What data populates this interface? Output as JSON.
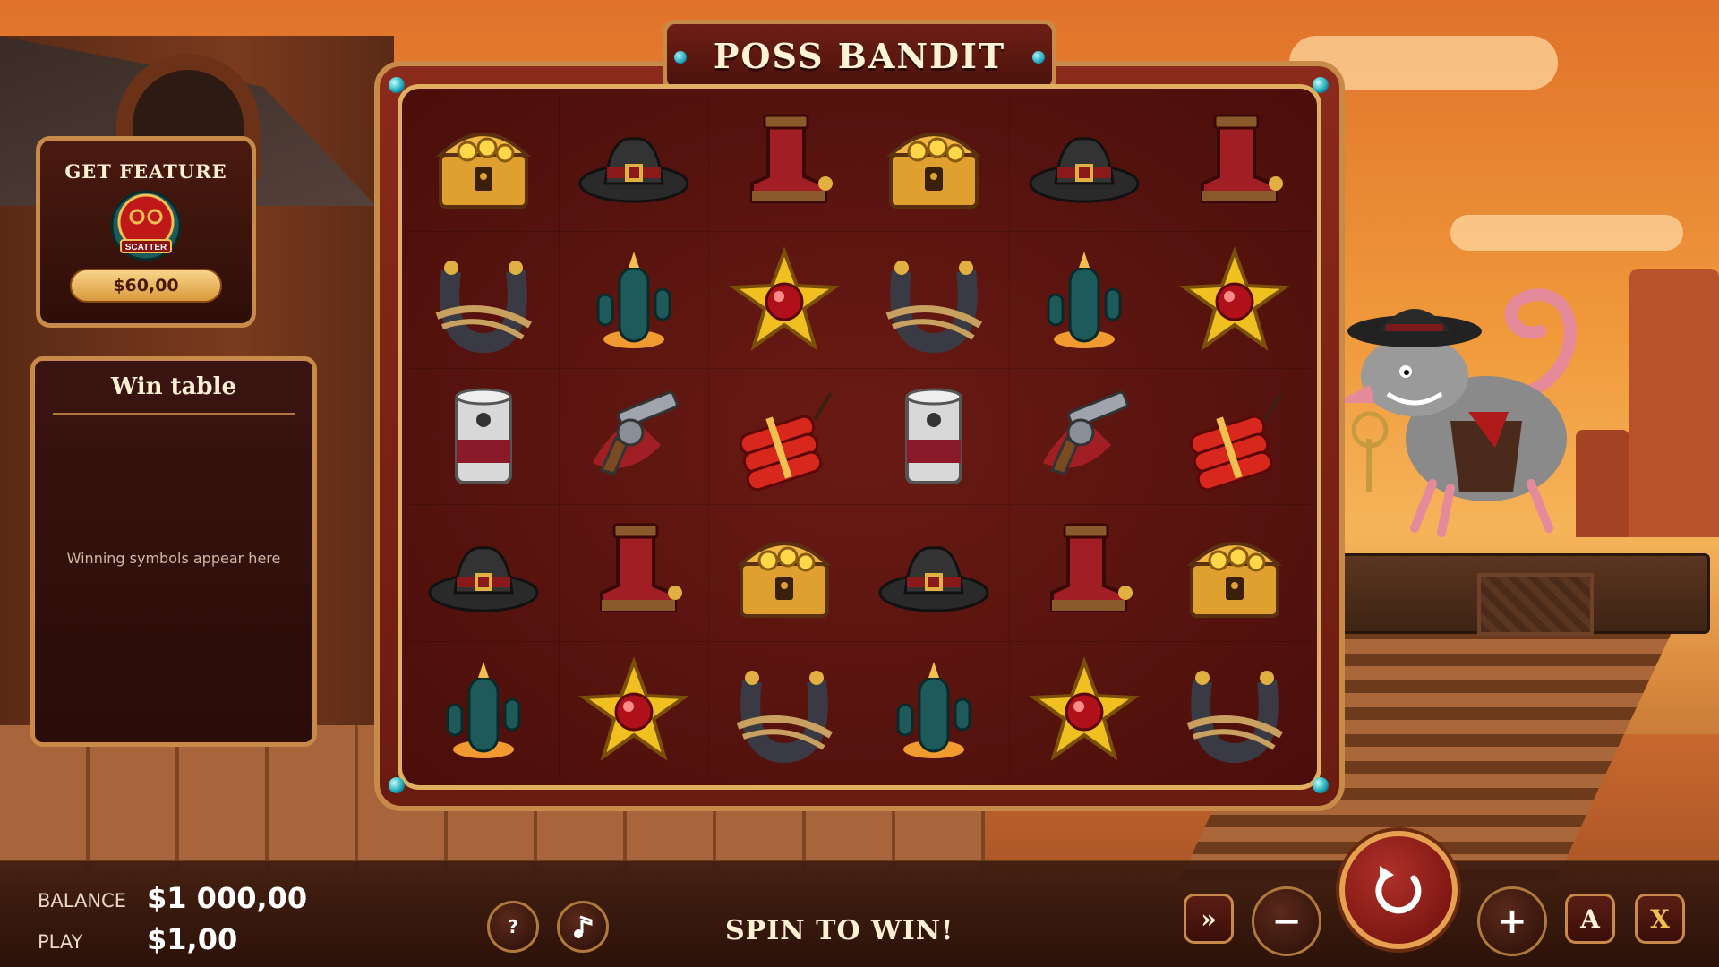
{
  "game": {
    "title": "POSS BANDIT"
  },
  "feature": {
    "title": "GET FEATURE",
    "badge_text": "SCATTER",
    "price": "$60,00"
  },
  "win_table": {
    "title": "Win table",
    "empty_text": "Winning symbols appear here"
  },
  "grid": {
    "rows": [
      [
        "chest-icon",
        "hat-icon",
        "boot-icon",
        "chest-icon",
        "hat-icon",
        "boot-icon"
      ],
      [
        "horseshoe-icon",
        "cactus-icon",
        "star-icon",
        "horseshoe-icon",
        "cactus-icon",
        "star-icon"
      ],
      [
        "can-icon",
        "revolver-icon",
        "dynamite-icon",
        "can-icon",
        "revolver-icon",
        "dynamite-icon"
      ],
      [
        "hat-icon",
        "boot-icon",
        "chest-icon",
        "hat-icon",
        "boot-icon",
        "chest-icon"
      ],
      [
        "cactus-icon",
        "star-icon",
        "horseshoe-icon",
        "cactus-icon",
        "star-icon",
        "horseshoe-icon"
      ]
    ]
  },
  "bottom": {
    "balance_label": "BALANCE",
    "balance_value": "$1 000,00",
    "play_label": "PLAY",
    "play_value": "$1,00",
    "help_label": "?",
    "spin_message": "SPIN TO WIN!",
    "turbo_label": "»",
    "minus_label": "−",
    "plus_label": "+",
    "auto_label": "A",
    "extra_label": "X"
  },
  "colors": {
    "accent": "#c88a48",
    "frame": "#6a1c10",
    "spin": "#b0302a"
  }
}
